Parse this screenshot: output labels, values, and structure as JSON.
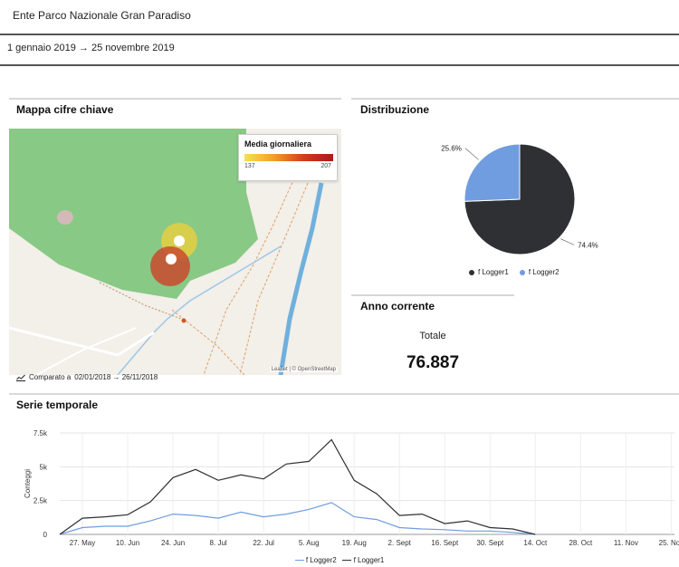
{
  "header": {
    "organization": "Ente Parco Nazionale Gran Paradiso",
    "date_range": "1 gennaio 2019 → 25 novembre 2019"
  },
  "map_section": {
    "title": "Mappa cifre chiave",
    "legend_title": "Media giornaliera",
    "legend_min": "137",
    "legend_max": "207",
    "attribution": "Leaflet | © OpenStreetMap",
    "compare_prefix": "Comparato a",
    "compare_dates": "02/01/2018 → 26/11/2018",
    "compare_icon": "trend-chart-icon"
  },
  "distribution": {
    "title": "Distribuzione"
  },
  "current_year": {
    "title": "Anno corrente",
    "total_label": "Totale",
    "total_value": "76.887"
  },
  "timeseries": {
    "title": "Serie temporale"
  },
  "colors": {
    "logger1": "#2f3034",
    "logger2": "#6f9de0",
    "park_green": "#7cc47a",
    "map_bg": "#f3efe9"
  },
  "chart_data": [
    {
      "type": "pie",
      "slices": [
        {
          "name": "f Logger1",
          "value": 74.4,
          "label": "74.4%"
        },
        {
          "name": "f Logger2",
          "value": 25.6,
          "label": "25.6%"
        }
      ],
      "legend": [
        "f Logger1",
        "f Logger2"
      ],
      "legend_position": "bottom"
    },
    {
      "type": "line",
      "ylabel": "Conteggi",
      "ylim": [
        0,
        7500
      ],
      "yticks": [
        "0",
        "2.5k",
        "5k",
        "7.5k"
      ],
      "ytick_values": [
        0,
        2500,
        5000,
        7500
      ],
      "xlim": [
        "2019-05-20",
        "2019-11-26"
      ],
      "xticks": [
        "27. May",
        "10. Jun",
        "24. Jun",
        "8. Jul",
        "22. Jul",
        "5. Aug",
        "19. Aug",
        "2. Sept",
        "16. Sept",
        "30. Sept",
        "14. Oct",
        "28. Oct",
        "11. Nov",
        "25. Nov"
      ],
      "xtick_dates": [
        "2019-05-27",
        "2019-06-10",
        "2019-06-24",
        "2019-07-08",
        "2019-07-22",
        "2019-08-05",
        "2019-08-19",
        "2019-09-02",
        "2019-09-16",
        "2019-09-30",
        "2019-10-14",
        "2019-10-28",
        "2019-11-11",
        "2019-11-25"
      ],
      "x": [
        "2019-05-20",
        "2019-05-27",
        "2019-06-03",
        "2019-06-10",
        "2019-06-17",
        "2019-06-24",
        "2019-07-01",
        "2019-07-08",
        "2019-07-15",
        "2019-07-22",
        "2019-07-29",
        "2019-08-05",
        "2019-08-12",
        "2019-08-19",
        "2019-08-26",
        "2019-09-02",
        "2019-09-09",
        "2019-09-16",
        "2019-09-23",
        "2019-09-30",
        "2019-10-07",
        "2019-10-14"
      ],
      "series": [
        {
          "name": "f Logger2",
          "color": "#6f9de0",
          "values": [
            0,
            500,
            600,
            600,
            1000,
            1500,
            1400,
            1200,
            1650,
            1300,
            1500,
            1850,
            2350,
            1300,
            1100,
            500,
            400,
            350,
            250,
            250,
            150,
            0
          ]
        },
        {
          "name": "f Logger1",
          "color": "#2f3034",
          "values": [
            0,
            1200,
            1300,
            1450,
            2400,
            4200,
            4800,
            4000,
            4400,
            4100,
            5200,
            5400,
            7000,
            4000,
            3000,
            1400,
            1500,
            800,
            1000,
            500,
            400,
            0
          ]
        }
      ],
      "legend": [
        "f Logger2",
        "f Logger1"
      ],
      "legend_position": "bottom",
      "grid": true
    }
  ]
}
